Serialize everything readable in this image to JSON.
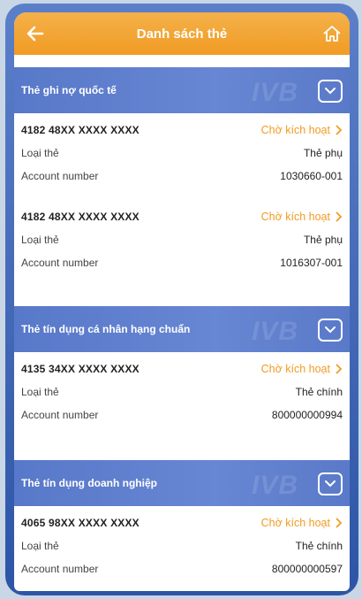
{
  "header": {
    "title": "Danh sách thẻ"
  },
  "sections": [
    {
      "title": "Thẻ ghi nợ quốc tế",
      "watermark": "IVB",
      "cards": [
        {
          "number": "4182 48XX XXXX XXXX",
          "status": "Chờ kích hoạt",
          "type_label": "Loại thẻ",
          "type_value": "Thẻ phụ",
          "account_label": "Account number",
          "account_value": "1030660-001"
        },
        {
          "number": "4182 48XX XXXX XXXX",
          "status": "Chờ kích hoạt",
          "type_label": "Loại thẻ",
          "type_value": "Thẻ phụ",
          "account_label": "Account number",
          "account_value": "1016307-001"
        }
      ]
    },
    {
      "title": "Thẻ tín dụng cá nhân hạng chuẩn",
      "watermark": "IVB",
      "cards": [
        {
          "number": "4135 34XX XXXX XXXX",
          "status": "Chờ kích hoạt",
          "type_label": "Loại thẻ",
          "type_value": "Thẻ chính",
          "account_label": "Account number",
          "account_value": "800000000994"
        }
      ]
    },
    {
      "title": "Thẻ tín dụng doanh nghiệp",
      "watermark": "IVB",
      "cards": [
        {
          "number": "4065 98XX XXXX XXXX",
          "status": "Chờ kích hoạt",
          "type_label": "Loại thẻ",
          "type_value": "Thẻ chính",
          "account_label": "Account number",
          "account_value": "800000000597"
        }
      ]
    }
  ],
  "colors": {
    "accent": "#f19b23",
    "section": "#5b7bcb"
  },
  "icons": {
    "back": "arrow-left-icon",
    "home": "home-icon",
    "toggle": "chevron-down-icon",
    "status": "chevron-right-icon"
  }
}
